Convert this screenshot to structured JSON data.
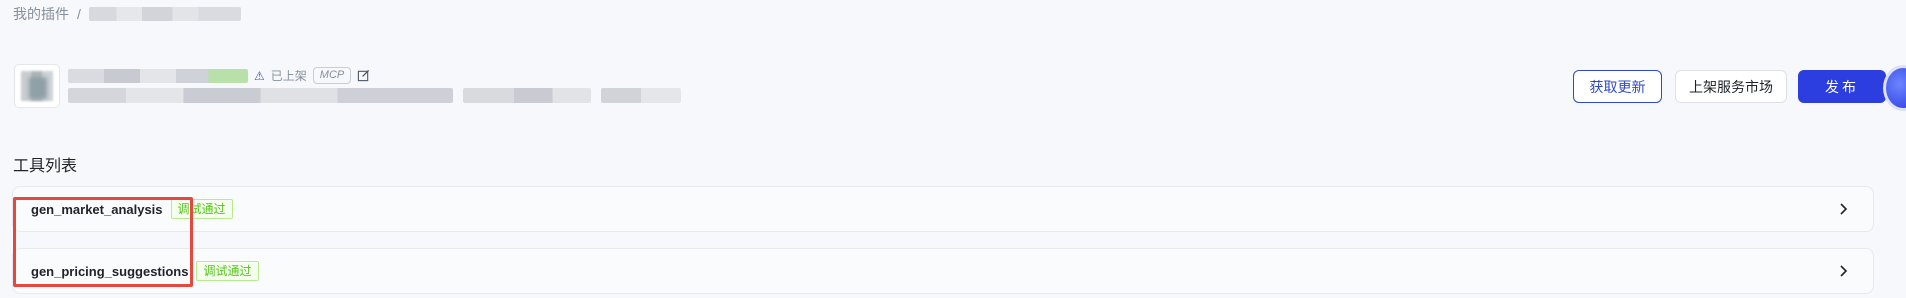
{
  "breadcrumb": {
    "root": "我的插件",
    "separator": "/"
  },
  "plugin": {
    "status": "已上架",
    "tag": "MCP"
  },
  "actions": {
    "update": "获取更新",
    "market": "上架服务市场",
    "publish": "发布"
  },
  "section": {
    "title": "工具列表"
  },
  "tools": [
    {
      "name": "gen_market_analysis",
      "status": "调试通过"
    },
    {
      "name": "gen_pricing_suggestions",
      "status": "调试通过"
    }
  ],
  "colors": {
    "accent": "#2c3ee0",
    "success": "#52c41a",
    "highlight": "#e5483f"
  },
  "icons": [
    "warning-icon",
    "edit-icon",
    "chevron-right-icon",
    "assistant-icon"
  ]
}
